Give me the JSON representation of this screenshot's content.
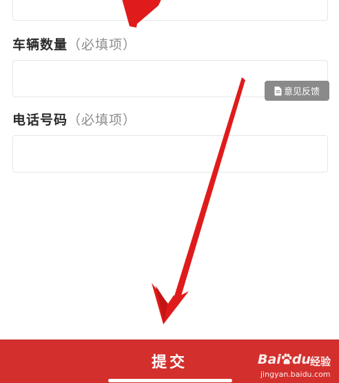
{
  "form": {
    "quantity": {
      "label": "车辆数量",
      "required_hint": "（必填项）",
      "value": ""
    },
    "phone": {
      "label": "电话号码",
      "required_hint": "（必填项）",
      "value": ""
    }
  },
  "feedback_button": {
    "label": "意见反馈",
    "icon": "document-icon"
  },
  "submit_button": {
    "label": "提交"
  },
  "watermark": {
    "brand": "Bai",
    "brand_mid": "du",
    "brand_tail": "经验",
    "url": "jingyan.baidu.com"
  },
  "colors": {
    "submit_red": "#d3302d",
    "arrow_red": "#e01b1b",
    "feedback_gray": "#8a8a8a",
    "label_dark": "#2b2b2b",
    "hint_gray": "#8c8c8c",
    "border_gray": "#e6e6e6"
  }
}
